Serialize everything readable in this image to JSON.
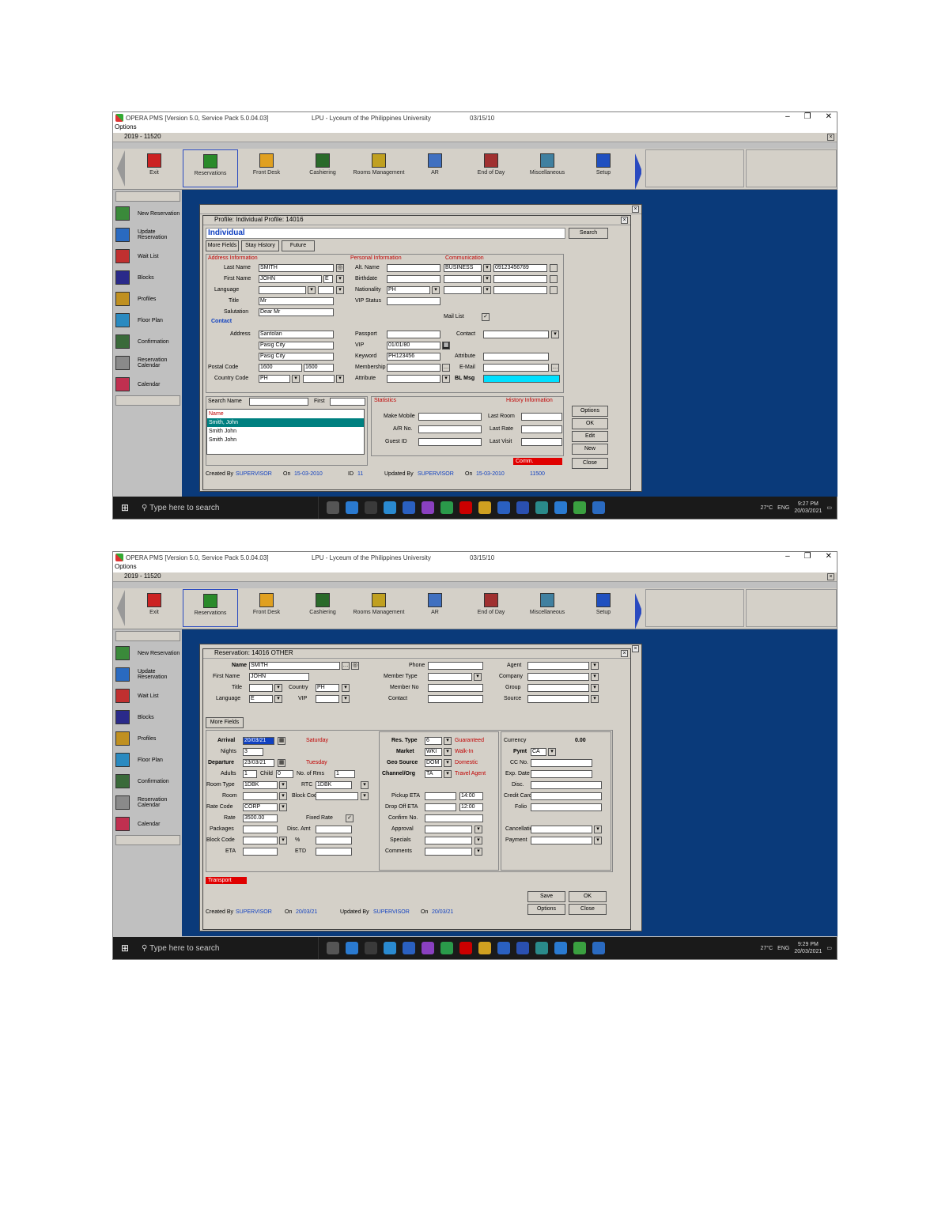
{
  "common": {
    "title_app": "OPERA PMS [Version 5.0, Service Pack 5.0.04.03]",
    "title_property": "LPU - Lyceum of the Philippines University",
    "title_date": "03/15/10",
    "menu_label": "Options",
    "subtitle": "2019 - 11520",
    "subtitle_close": "×",
    "window_controls": [
      "–",
      "❐",
      "✕"
    ],
    "toolbar": [
      {
        "label": "Exit",
        "icon": "exit-icon",
        "color": "#cc2222"
      },
      {
        "label": "Reservations",
        "icon": "reservations-icon",
        "color": "#2a8a2a"
      },
      {
        "label": "Front Desk",
        "icon": "front-desk-icon",
        "color": "#e0a020"
      },
      {
        "label": "Cashiering",
        "icon": "cashiering-icon",
        "color": "#2a6a2a"
      },
      {
        "label": "Rooms Management",
        "icon": "rooms-icon",
        "color": "#c0a020"
      },
      {
        "label": "AR",
        "icon": "ar-icon",
        "color": "#4070c0"
      },
      {
        "label": "End of Day",
        "icon": "end-of-day-icon",
        "color": "#a03030"
      },
      {
        "label": "Miscellaneous",
        "icon": "misc-icon",
        "color": "#4080a0"
      },
      {
        "label": "Setup",
        "icon": "setup-icon",
        "color": "#2050c0"
      }
    ],
    "sidebar": [
      {
        "label": "New Reservation",
        "icon": "new-reservation-icon"
      },
      {
        "label": "Update Reservation",
        "icon": "update-reservation-icon"
      },
      {
        "label": "Wait List",
        "icon": "wait-list-icon"
      },
      {
        "label": "Blocks",
        "icon": "blocks-icon"
      },
      {
        "label": "Profiles",
        "icon": "profiles-icon"
      },
      {
        "label": "Floor Plan",
        "icon": "floor-plan-icon"
      },
      {
        "label": "Confirmation",
        "icon": "confirmation-icon"
      },
      {
        "label": "Reservation Calendar",
        "icon": "calendar-icon"
      },
      {
        "label": "Calendar",
        "icon": "calendar2-icon"
      }
    ],
    "taskbar": {
      "search_placeholder": "Type here to search",
      "weather": "27°C",
      "lang": "ENG",
      "time1": "9:27 PM",
      "time2": "9:29 PM",
      "date": "20/03/2021"
    }
  },
  "profile": {
    "title": "Profile: Individual  Profile: 14016",
    "heading": "Individual",
    "tabs": [
      "More Fields",
      "Stay History",
      "Future"
    ],
    "search_btn": "Search",
    "address_header": "Address Information",
    "personal_header": "Personal Information",
    "comm_header": "Communication",
    "labels": {
      "last_name": "Last Name",
      "first_name": "First Name",
      "language": "Language",
      "title": "Title",
      "salutation": "Salutation",
      "address": "Address",
      "city": "City",
      "postal": "Postal Code",
      "country": "Country Code",
      "alt_name": "Alt. Name",
      "birthdate": "Birthdate",
      "vip": "VIP",
      "vip_status": "VIP Status",
      "passport": "Passport",
      "nationality": "Nationality",
      "keyword": "Keyword",
      "membership": "Membership",
      "attribute": "Attribute",
      "email": "E-Mail",
      "bl_msg": "BL Msg",
      "mail_list": "Mail List",
      "contact": "Contact",
      "business": "BUSINESS"
    },
    "values": {
      "last_name": "SMITH",
      "first_name": "JOHN",
      "language": "E",
      "title": "Mr",
      "salutation": "Dear Mr",
      "address1": "Santolan",
      "address2": "Pasig City",
      "postal": "1600",
      "country": "PH",
      "birthdate": "01/01/80",
      "nationality": "PH",
      "phone": "09123456789",
      "vip": "No",
      "passport": "PH123456"
    },
    "search_name_label": "Search Name",
    "search_first_label": "First",
    "list_header": "Name",
    "list_items": [
      "Smith, John",
      "Smith John",
      "Smith John"
    ],
    "stats_header": "Statistics",
    "history_header": "History Information",
    "stats_labels": [
      "Make Mobile",
      "A/R No.",
      "Guest ID"
    ],
    "history_labels": [
      "Last Room",
      "Last Rate",
      "Last Visit"
    ],
    "buttons": [
      "Options",
      "OK",
      "Edit",
      "New",
      "Close"
    ],
    "comm_bar": "Comm.",
    "footer": {
      "created_by_label": "Created By",
      "created_by": "SUPERVISOR",
      "on_label": "On",
      "on": "15-03-2010",
      "id_label": "ID",
      "id": "11",
      "updated_by_label": "Updated By",
      "updated_by": "SUPERVISOR",
      "updated_on": "15-03-2010",
      "updated_id": "11500"
    }
  },
  "reservation": {
    "title": "Reservation: 14016  OTHER",
    "labels": {
      "name": "Name",
      "first_name": "First Name",
      "title": "Title",
      "country": "Country",
      "language": "Language",
      "vip": "VIP",
      "member": "Member Type",
      "phone": "Phone",
      "company": "Company",
      "group": "Group",
      "source": "Source",
      "contact": "Contact",
      "agent": "Agent",
      "member_no": "Member No",
      "arrival": "Arrival",
      "nights": "Nights",
      "departure": "Departure",
      "adults": "Adults",
      "child": "Child",
      "no_of_rooms": "No. of Rms",
      "room_type": "Room Type",
      "rtc": "RTC",
      "room": "Room",
      "block": "Block Code",
      "rate_code": "Rate Code",
      "rate": "Rate",
      "fixed_rate": "Fixed Rate",
      "pkgs": "Packages",
      "disc_amt": "Disc. Amt",
      "disc_pct": "%",
      "block_code": "Block Code",
      "eta": "ETA",
      "etd": "ETD",
      "res_type": "Res. Type",
      "market": "Market",
      "geo_source": "Geo Source",
      "channel": "Channel/Org",
      "pickup": "Pickup ETA",
      "drop": "Drop Off ETA",
      "confirm_no": "Confirm No.",
      "approval": "Approval",
      "cxl": "Cancellation",
      "payment": "Payment",
      "credit_card": "Credit Card",
      "pymt": "Pymt",
      "cc_no": "CC No.",
      "exp": "Exp. Date",
      "folio": "Folio",
      "specials": "Specials",
      "comments": "Comments",
      "disc": "Disc.",
      "ccy": "Currency"
    },
    "values": {
      "name": "SMITH",
      "first_name": "JOHN",
      "country": "PH",
      "language": "E",
      "arrival": "20/03/21",
      "nights": "3",
      "departure": "23/03/21",
      "adults": "1",
      "child": "0",
      "no_of_rooms": "1",
      "room_type": "1DBK",
      "rtc": "1DBK",
      "rate_code": "CORP",
      "rate": "3500.00",
      "res_type": "6",
      "market": "WKI",
      "geo": "DOM",
      "channel": "TA",
      "eta": "14:00",
      "etd": "12:00",
      "pymt": "CA",
      "currency": "PHP",
      "pickup": "14:00",
      "drop": "12:00",
      "arr_day": "Saturday",
      "dep_day": "Tuesday",
      "res_day": "Guaranteed",
      "market_desc": "Walk-In",
      "geo_desc": "Domestic",
      "channel_desc": "Travel Agent",
      "balance": "0.00"
    },
    "section_more": "More Fields",
    "transport_bar": "Transport",
    "buttons": [
      "Save",
      "OK",
      "Options",
      "Close"
    ],
    "footer": {
      "created_by_label": "Created By",
      "created_by": "SUPERVISOR",
      "on_label": "On",
      "on": "20/03/21",
      "updated_by_label": "Updated By",
      "updated_by": "SUPERVISOR",
      "updated_on": "20/03/21"
    }
  }
}
